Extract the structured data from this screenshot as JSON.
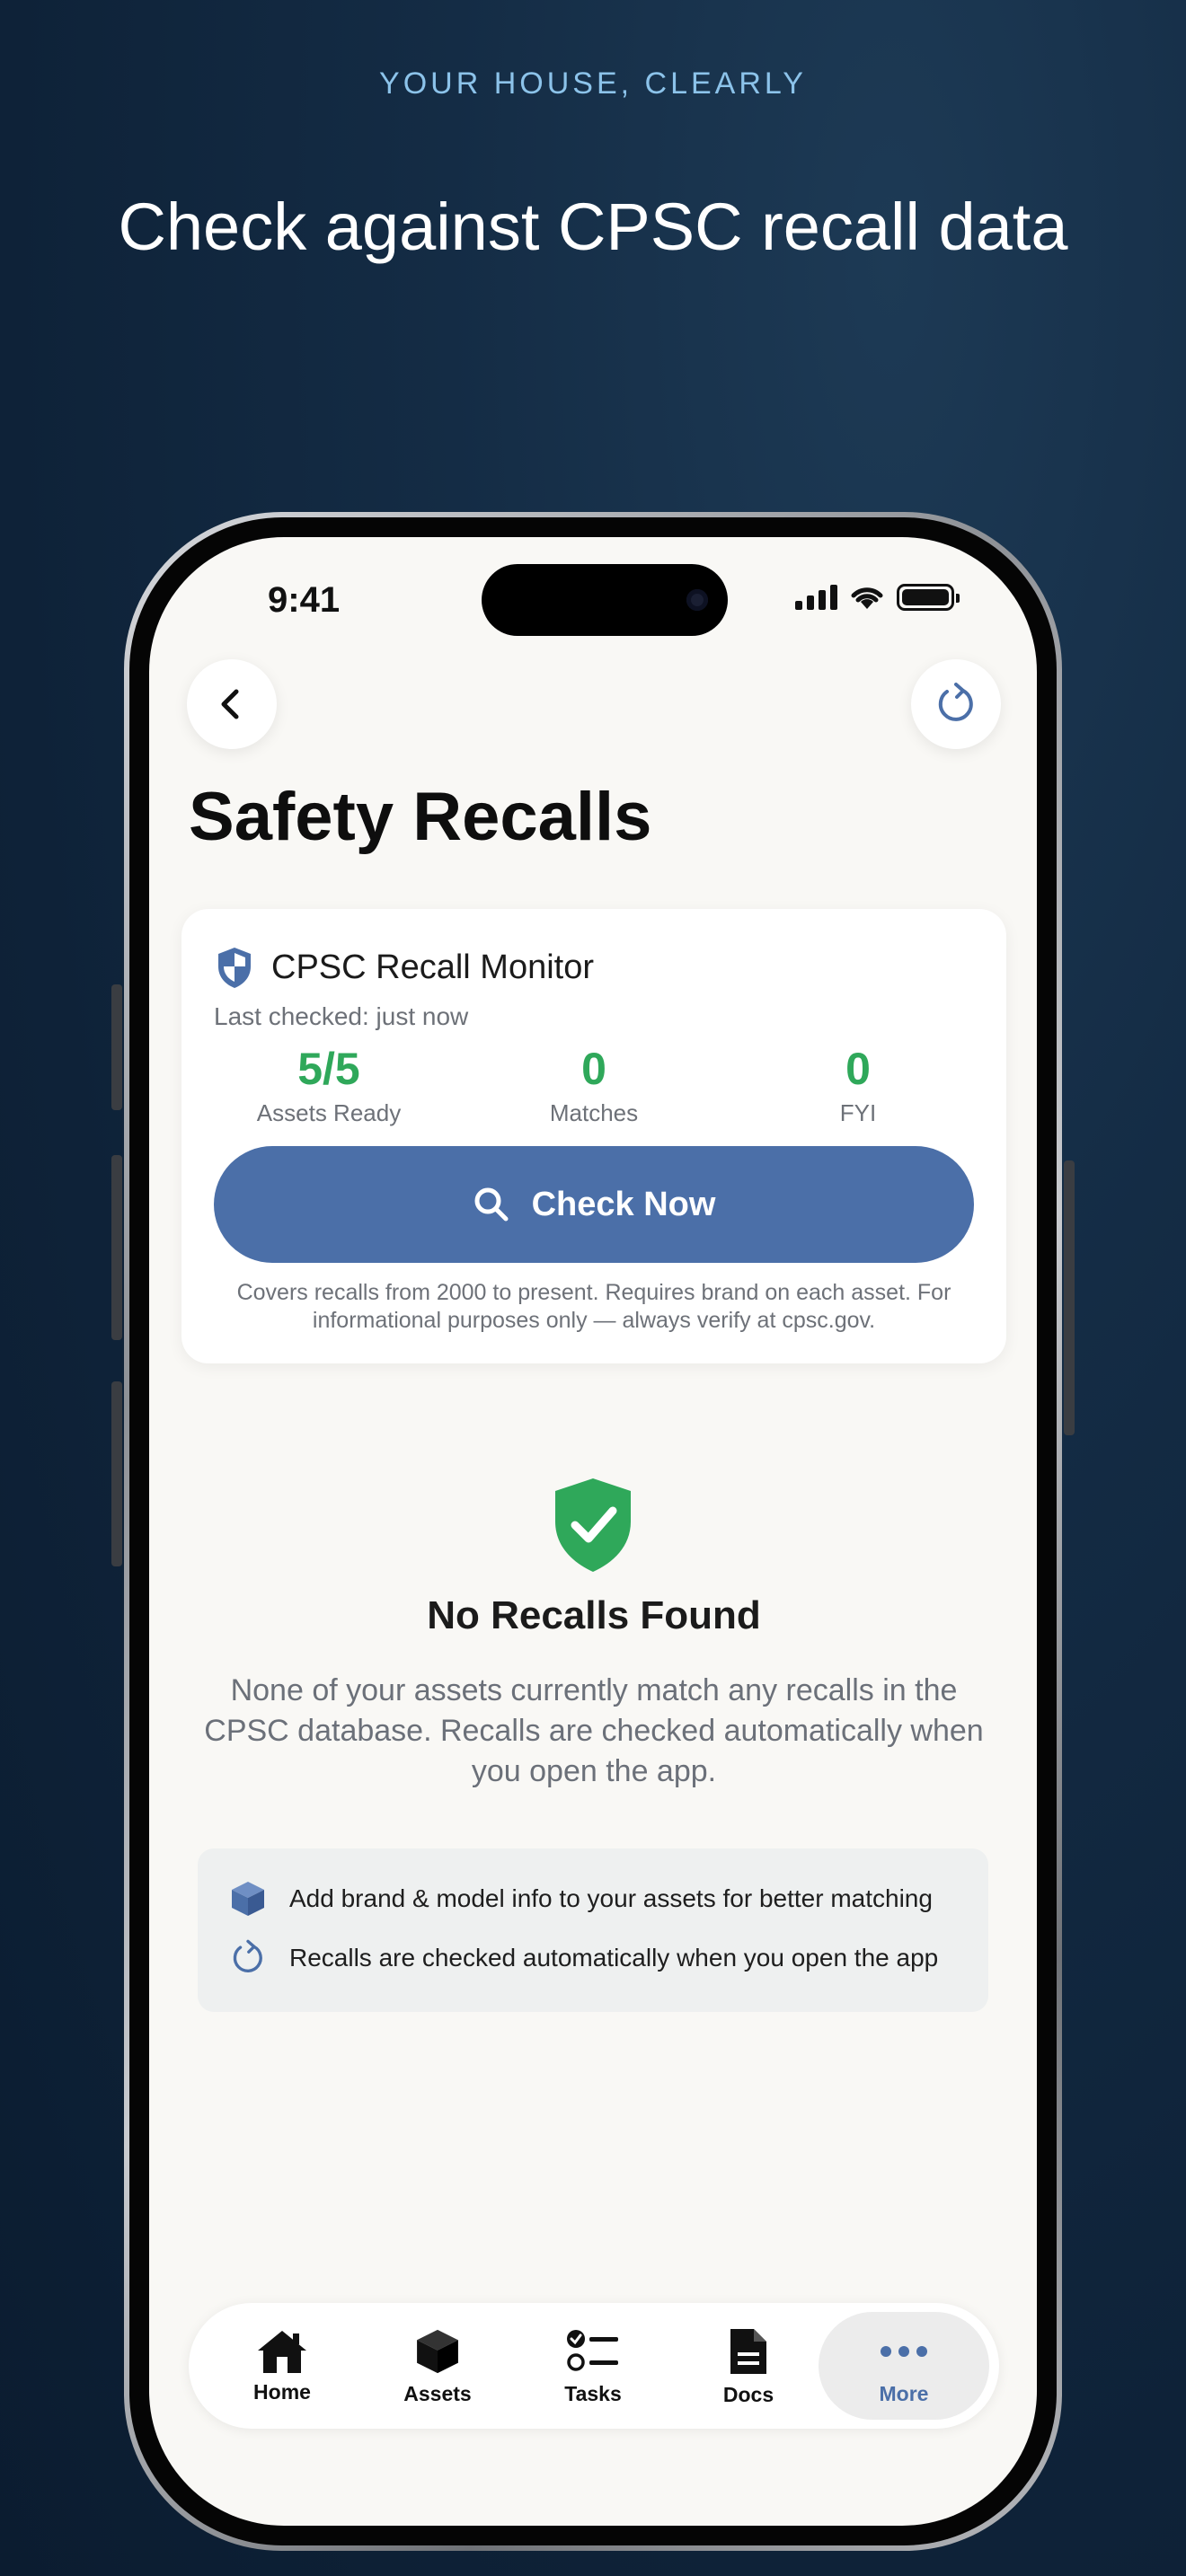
{
  "marketing": {
    "tagline": "YOUR HOUSE, CLEARLY",
    "headline": "Check against CPSC recall data"
  },
  "status_bar": {
    "time": "9:41"
  },
  "header": {
    "back_icon": "chevron-left-icon",
    "refresh_icon": "refresh-icon",
    "title": "Safety Recalls"
  },
  "monitor_card": {
    "title": "CPSC Recall Monitor",
    "last_checked": "Last checked: just now",
    "stats": [
      {
        "value": "5/5",
        "label": "Assets Ready"
      },
      {
        "value": "0",
        "label": "Matches"
      },
      {
        "value": "0",
        "label": "FYI"
      }
    ],
    "check_button_label": "Check Now",
    "disclaimer": "Covers recalls from 2000 to present. Requires brand on each asset. For informational purposes only — always verify at cpsc.gov."
  },
  "empty_state": {
    "title": "No Recalls Found",
    "description": "None of your assets currently match any recalls in the CPSC database. Recalls are checked automatically when you open the app."
  },
  "tips": [
    {
      "icon": "cube-icon",
      "text": "Add brand & model info to your assets for better matching"
    },
    {
      "icon": "refresh-icon",
      "text": "Recalls are checked automatically when you open the app"
    }
  ],
  "tab_bar": {
    "tabs": [
      {
        "label": "Home",
        "icon": "home-icon"
      },
      {
        "label": "Assets",
        "icon": "cube-icon"
      },
      {
        "label": "Tasks",
        "icon": "checklist-icon"
      },
      {
        "label": "Docs",
        "icon": "document-icon"
      },
      {
        "label": "More",
        "icon": "ellipsis-icon"
      }
    ],
    "active_tab": "More"
  },
  "colors": {
    "accent": "#4b6fa8",
    "success": "#2fa85a",
    "background": "#f9f8f5"
  }
}
